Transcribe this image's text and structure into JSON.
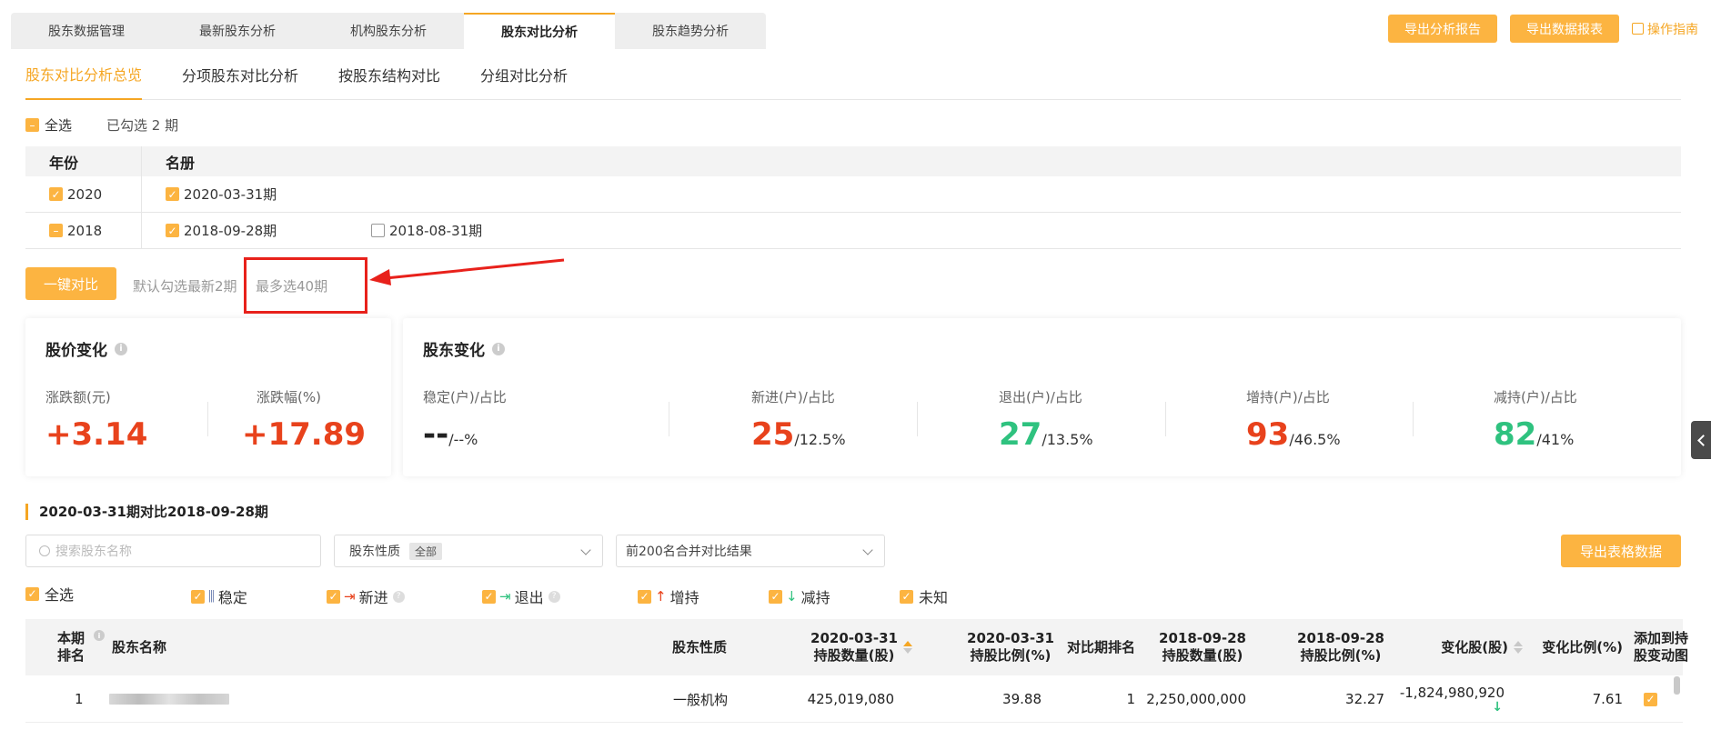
{
  "top_tabs": [
    "股东数据管理",
    "最新股东分析",
    "机构股东分析",
    "股东对比分析",
    "股东趋势分析"
  ],
  "top_actions": {
    "export_report": "导出分析报告",
    "export_data": "导出数据报表",
    "guide": "操作指南"
  },
  "sub_tabs": [
    "股东对比分析总览",
    "分项股东对比分析",
    "按股东结构对比",
    "分组对比分析"
  ],
  "selection": {
    "select_all": "全选",
    "selected_count": "已勾选 2 期"
  },
  "period_table": {
    "headers": {
      "year": "年份",
      "names": "名册"
    },
    "rows": [
      {
        "year": "2020",
        "items": [
          {
            "label": "2020-03-31期",
            "checked": true
          }
        ]
      },
      {
        "year": "2018",
        "items": [
          {
            "label": "2018-09-28期",
            "checked": true
          },
          {
            "label": "2018-08-31期",
            "checked": false
          }
        ]
      }
    ]
  },
  "compare": {
    "button": "一键对比",
    "hint_default": "默认勾选最新2期",
    "hint_max": "最多选40期"
  },
  "price_card": {
    "title": "股价变化",
    "amount_label": "涨跌额(元)",
    "amount_value": "+3.14",
    "pct_label": "涨跌幅(%)",
    "pct_value": "+17.89"
  },
  "holder_card": {
    "title": "股东变化",
    "metrics": [
      {
        "label": "稳定(户)/占比",
        "value": "--",
        "pct": "/--%"
      },
      {
        "label": "新进(户)/占比",
        "value": "25",
        "pct": "/12.5%"
      },
      {
        "label": "退出(户)/占比",
        "value": "27",
        "pct": "/13.5%"
      },
      {
        "label": "增持(户)/占比",
        "value": "93",
        "pct": "/46.5%"
      },
      {
        "label": "减持(户)/占比",
        "value": "82",
        "pct": "/41%"
      }
    ]
  },
  "section": {
    "title": "2020-03-31期对比2018-09-28期"
  },
  "filters": {
    "search_placeholder": "搜索股东名称",
    "nature_label": "股东性质",
    "nature_tag": "全部",
    "merge_option": "前200名合并对比结果",
    "export_table": "导出表格数据"
  },
  "legend": {
    "all": "全选",
    "stable": "稳定",
    "new": "新进",
    "exit": "退出",
    "increase": "增持",
    "decrease": "减持",
    "unknown": "未知"
  },
  "table": {
    "headers": {
      "rank_1": "本期",
      "rank_2": "排名",
      "name": "股东名称",
      "nature": "股东性质",
      "hold_cur_1": "2020-03-31",
      "hold_cur_2": "持股数量(股)",
      "ratio_cur_1": "2020-03-31",
      "ratio_cur_2": "持股比例(%)",
      "rank_prev": "对比期排名",
      "hold_prev_1": "2018-09-28",
      "hold_prev_2": "持股数量(股)",
      "ratio_prev_1": "2018-09-28",
      "ratio_prev_2": "持股比例(%)",
      "change": "变化股(股)",
      "change_ratio": "变化比例(%)",
      "add_1": "添加到持",
      "add_2": "股变动图"
    },
    "rows": [
      {
        "rank": "1",
        "nature": "一般机构",
        "hold_cur": "425,019,080",
        "ratio_cur": "39.88",
        "rank_prev": "1",
        "hold_prev": "2,250,000,000",
        "ratio_prev": "32.27",
        "change": "-1,824,980,920",
        "change_ratio": "7.61"
      }
    ]
  },
  "colors": {
    "accent": "#f5a623",
    "button": "#fcb441",
    "rise": "#e8421c",
    "fall": "#2fc27f",
    "annotation": "#e8211b"
  }
}
